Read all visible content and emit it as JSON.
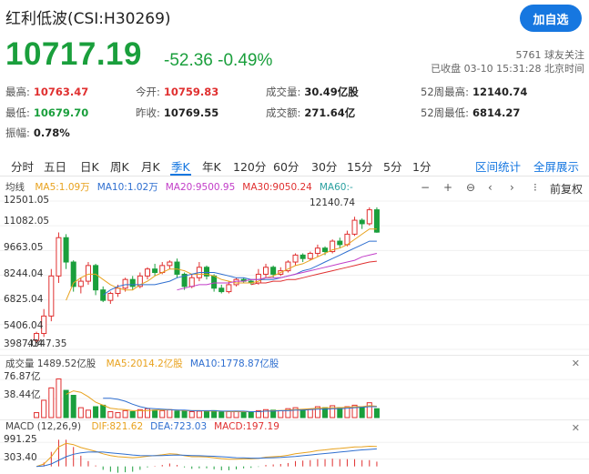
{
  "header": {
    "title": "红利低波(CSI:H30269)",
    "add_button": "加自选",
    "price": "10717.19",
    "change": "-52.36",
    "change_pct": "-0.49%",
    "followers": "5761  球友关注",
    "status": "已收盘 03-10 15:31:28 北京时间"
  },
  "stats": [
    {
      "label": "最高:",
      "value": "10763.47",
      "color": "#e03030"
    },
    {
      "label": "今开:",
      "value": "10759.83",
      "color": "#e03030"
    },
    {
      "label": "成交量:",
      "value": "30.49亿股",
      "color": "#222"
    },
    {
      "label": "52周最高:",
      "value": "12140.74",
      "color": "#222"
    },
    {
      "label": "最低:",
      "value": "10679.70",
      "color": "#1a9f3c"
    },
    {
      "label": "昨收:",
      "value": "10769.55",
      "color": "#222"
    },
    {
      "label": "成交额:",
      "value": "271.64亿",
      "color": "#222"
    },
    {
      "label": "52周最低:",
      "value": "6814.27",
      "color": "#222"
    },
    {
      "label": "振幅:",
      "value": "0.78%",
      "color": "#222"
    }
  ],
  "tabs": [
    "分时",
    "五日",
    "日K",
    "周K",
    "月K",
    "季K",
    "年K",
    "120分",
    "60分",
    "30分",
    "15分",
    "5分",
    "1分"
  ],
  "active_tab": "季K",
  "tabs_right": [
    "区间统计",
    "全屏展示"
  ],
  "chart_controls": {
    "fuquan": "前复权"
  },
  "ma_legend": {
    "label": "均线",
    "items": [
      {
        "text": "MA5:1.09万",
        "color": "#e8a21e"
      },
      {
        "text": "MA10:1.02万",
        "color": "#2f6fd0"
      },
      {
        "text": "MA20:9500.95",
        "color": "#c23ec8"
      },
      {
        "text": "MA30:9050.24",
        "color": "#e03030"
      },
      {
        "text": "MA60:-",
        "color": "#2aa0a0"
      }
    ]
  },
  "vol_legend": {
    "label": "成交量 1489.52亿股",
    "items": [
      {
        "text": "MA5:2014.2亿股",
        "color": "#e8a21e"
      },
      {
        "text": "MA10:1778.87亿股",
        "color": "#2f6fd0"
      }
    ]
  },
  "macd_legend": {
    "label": "MACD (12,26,9)",
    "items": [
      {
        "text": "DIF:821.62",
        "color": "#e8a21e"
      },
      {
        "text": "DEA:723.03",
        "color": "#2f6fd0"
      },
      {
        "text": "MACD:197.19",
        "color": "#e03030"
      }
    ]
  },
  "price_axis": [
    "12501.05",
    "11082.05",
    "9663.05",
    "8244.04",
    "6825.04",
    "5406.04",
    "3987.04"
  ],
  "price_low_label": "4347.35",
  "price_high_label": "12140.74",
  "vol_axis": [
    "76.87亿",
    "38.44亿"
  ],
  "macd_axis": [
    "991.25",
    "303.40"
  ],
  "colors": {
    "up": "#e03030",
    "down": "#1a9f3c",
    "accent": "#1677e0"
  },
  "chart_data": [
    {
      "type": "candlestick",
      "title": "",
      "ylim": [
        3987.04,
        12501.05
      ],
      "y_ticks": [
        12501.05,
        11082.05,
        9663.05,
        8244.04,
        6825.04,
        5406.04,
        3987.04
      ],
      "annotations": [
        {
          "text": "12140.74",
          "kind": "high"
        },
        {
          "text": "4347.35",
          "kind": "low"
        }
      ],
      "series": [
        {
          "name": "K",
          "ohlc": [
            [
              4500,
              4900,
              4347,
              5000
            ],
            [
              4900,
              5900,
              4700,
              6300
            ],
            [
              5900,
              8200,
              5600,
              8600
            ],
            [
              8200,
              10400,
              7800,
              10700
            ],
            [
              10400,
              9000,
              8600,
              10600
            ],
            [
              9000,
              7600,
              7300,
              9100
            ],
            [
              7600,
              7900,
              7200,
              8100
            ],
            [
              7900,
              8800,
              7700,
              9000
            ],
            [
              8800,
              7400,
              7100,
              8900
            ],
            [
              7400,
              6800,
              6700,
              7600
            ],
            [
              6800,
              7200,
              6600,
              7300
            ],
            [
              7200,
              7500,
              7000,
              7700
            ],
            [
              7500,
              8000,
              7300,
              8100
            ],
            [
              8000,
              7600,
              7400,
              8200
            ],
            [
              7600,
              8200,
              7500,
              8400
            ],
            [
              8200,
              8600,
              8000,
              8700
            ],
            [
              8600,
              8400,
              8200,
              8900
            ],
            [
              8400,
              8800,
              8300,
              9000
            ],
            [
              8800,
              9000,
              8600,
              9100
            ],
            [
              9000,
              8300,
              8100,
              9200
            ],
            [
              8300,
              7600,
              7400,
              8400
            ],
            [
              7600,
              8100,
              7500,
              8300
            ],
            [
              8100,
              8700,
              7900,
              9000
            ],
            [
              8700,
              8200,
              8000,
              8800
            ],
            [
              8200,
              7500,
              7300,
              8300
            ],
            [
              7500,
              7300,
              7200,
              7700
            ],
            [
              7300,
              7700,
              7200,
              7900
            ],
            [
              7700,
              8000,
              7600,
              8100
            ],
            [
              8000,
              7900,
              7800,
              8100
            ],
            [
              7900,
              7800,
              7700,
              8000
            ],
            [
              7800,
              8300,
              7700,
              8600
            ],
            [
              8300,
              8700,
              8100,
              8900
            ],
            [
              8700,
              8300,
              8100,
              8800
            ],
            [
              8300,
              8500,
              8200,
              8700
            ],
            [
              8500,
              9000,
              8400,
              9100
            ],
            [
              9000,
              9400,
              8800,
              9500
            ],
            [
              9400,
              9200,
              9000,
              9500
            ],
            [
              9200,
              9500,
              9100,
              9600
            ],
            [
              9500,
              9800,
              9300,
              10000
            ],
            [
              9800,
              9600,
              9400,
              9900
            ],
            [
              9600,
              10200,
              9500,
              10300
            ],
            [
              10200,
              10000,
              9800,
              10400
            ],
            [
              10000,
              10600,
              9900,
              10800
            ],
            [
              10600,
              11400,
              10500,
              11600
            ],
            [
              11400,
              11200,
              10900,
              11500
            ],
            [
              11200,
              12000,
              11100,
              12140.74
            ],
            [
              12000,
              10717,
              10680,
              12140
            ]
          ]
        },
        {
          "name": "MA5",
          "values": [
            null,
            null,
            null,
            null,
            6800,
            7800,
            8100,
            8300,
            8300,
            8000,
            7700,
            7500,
            7400,
            7400,
            7700,
            7900,
            8200,
            8400,
            8600,
            8600,
            8500,
            8300,
            8300,
            8300,
            8200,
            8000,
            7900,
            7800,
            7800,
            7800,
            7900,
            8100,
            8200,
            8400,
            8600,
            8800,
            8900,
            9100,
            9300,
            9500,
            9700,
            9800,
            10000,
            10300,
            10600,
            10900,
            10900
          ]
        },
        {
          "name": "MA10",
          "values": [
            null,
            null,
            null,
            null,
            null,
            null,
            null,
            null,
            null,
            7100,
            7400,
            7600,
            7700,
            7700,
            7700,
            7700,
            7700,
            7800,
            7900,
            8100,
            8200,
            8300,
            8400,
            8400,
            8400,
            8300,
            8200,
            8100,
            8100,
            8000,
            8000,
            8000,
            8000,
            8100,
            8200,
            8300,
            8500,
            8600,
            8800,
            9000,
            9200,
            9400,
            9600,
            9800,
            10000,
            10200,
            10200
          ]
        },
        {
          "name": "MA20",
          "values": [
            null,
            null,
            null,
            null,
            null,
            null,
            null,
            null,
            null,
            null,
            null,
            null,
            null,
            null,
            null,
            null,
            null,
            null,
            null,
            7400,
            7500,
            7600,
            7700,
            7700,
            7800,
            7800,
            7800,
            7900,
            7900,
            8000,
            8000,
            8100,
            8100,
            8100,
            8200,
            8300,
            8400,
            8500,
            8600,
            8700,
            8800,
            8900,
            9000,
            9100,
            9300,
            9400,
            9500
          ]
        },
        {
          "name": "MA30",
          "values": [
            null,
            null,
            null,
            null,
            null,
            null,
            null,
            null,
            null,
            null,
            null,
            null,
            null,
            null,
            null,
            null,
            null,
            null,
            null,
            null,
            null,
            null,
            null,
            null,
            null,
            null,
            null,
            null,
            null,
            7700,
            7800,
            7800,
            7900,
            7900,
            8000,
            8000,
            8100,
            8200,
            8300,
            8400,
            8500,
            8600,
            8700,
            8800,
            8900,
            9000,
            9050
          ]
        }
      ]
    },
    {
      "type": "bar",
      "title": "",
      "ylim": [
        0,
        90
      ],
      "y_ticks": [
        76.87,
        38.44
      ],
      "series": [
        {
          "name": "成交量",
          "values": [
            10,
            35,
            60,
            78,
            55,
            45,
            20,
            15,
            22,
            25,
            12,
            10,
            14,
            12,
            16,
            18,
            15,
            14,
            16,
            13,
            14,
            12,
            13,
            12,
            14,
            11,
            12,
            13,
            12,
            11,
            14,
            16,
            15,
            14,
            18,
            20,
            16,
            17,
            22,
            20,
            24,
            20,
            22,
            25,
            20,
            30,
            18
          ]
        },
        {
          "name": "MA5",
          "values": [
            null,
            null,
            null,
            null,
            47,
            54,
            51,
            42,
            31,
            25,
            19,
            17,
            16,
            14,
            14,
            14,
            15,
            15,
            16,
            15,
            14,
            14,
            14,
            13,
            13,
            13,
            12,
            12,
            12,
            12,
            12,
            13,
            14,
            14,
            15,
            16,
            17,
            18,
            19,
            20,
            20,
            20,
            21,
            22,
            22,
            24,
            23
          ]
        },
        {
          "name": "MA10",
          "values": [
            null,
            null,
            null,
            null,
            null,
            null,
            null,
            null,
            null,
            39,
            39,
            37,
            33,
            27,
            22,
            19,
            18,
            17,
            16,
            15,
            15,
            14,
            14,
            14,
            14,
            13,
            13,
            13,
            13,
            12,
            12,
            13,
            13,
            14,
            14,
            15,
            15,
            16,
            17,
            17,
            18,
            18,
            19,
            20,
            21,
            22,
            22
          ]
        }
      ]
    },
    {
      "type": "line",
      "title": "",
      "ylim": [
        -200,
        1300
      ],
      "y_ticks": [
        991.25,
        303.4
      ],
      "series": [
        {
          "name": "DIF",
          "values": [
            0,
            100,
            400,
            800,
            950,
            900,
            780,
            700,
            620,
            520,
            450,
            400,
            380,
            360,
            380,
            420,
            450,
            480,
            520,
            500,
            440,
            400,
            400,
            390,
            360,
            320,
            300,
            300,
            310,
            310,
            330,
            380,
            400,
            420,
            460,
            520,
            560,
            600,
            650,
            680,
            720,
            740,
            770,
            800,
            810,
            830,
            821.62
          ]
        },
        {
          "name": "DEA",
          "values": [
            0,
            20,
            100,
            250,
            400,
            500,
            560,
            590,
            600,
            590,
            560,
            530,
            500,
            470,
            450,
            440,
            440,
            450,
            460,
            470,
            460,
            450,
            440,
            430,
            420,
            400,
            380,
            360,
            350,
            340,
            340,
            350,
            360,
            370,
            390,
            410,
            440,
            470,
            500,
            530,
            560,
            590,
            620,
            650,
            680,
            700,
            723.03
          ]
        },
        {
          "name": "MACD",
          "values": [
            0,
            160,
            600,
            1100,
            1100,
            800,
            440,
            220,
            40,
            -140,
            -220,
            -260,
            -240,
            -220,
            -140,
            -40,
            20,
            60,
            120,
            60,
            -40,
            -100,
            -80,
            -80,
            -120,
            -160,
            -160,
            -120,
            -80,
            -60,
            -20,
            60,
            80,
            100,
            140,
            220,
            240,
            260,
            300,
            300,
            320,
            300,
            300,
            300,
            260,
            260,
            197.19
          ]
        }
      ]
    }
  ]
}
